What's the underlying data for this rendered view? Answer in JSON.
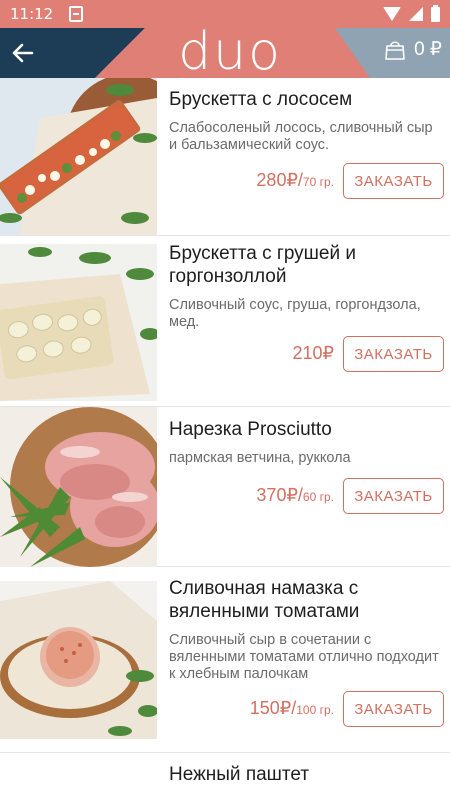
{
  "status_bar": {
    "time": "11:12"
  },
  "header": {
    "logo": "duo",
    "cart_count": "0 ₽"
  },
  "colors": {
    "accent": "#e07f75",
    "navy": "#1c3d55",
    "slate": "#8fa3b3",
    "price": "#d27061"
  },
  "menu": {
    "items": [
      {
        "name": "Брускетта с лососем",
        "description": "Слабосоленый лосось, сливочный сыр и бальзамический соус.",
        "price": "280₽/",
        "weight": "70 гр.",
        "button": "ЗАКАЗАТЬ"
      },
      {
        "name": "Брускетта с грушей и горгонзоллой",
        "description": "Сливочный соус, груша, горгондзола, мед.",
        "price": "210₽",
        "weight": "",
        "button": "ЗАКАЗАТЬ"
      },
      {
        "name": "Нарезка Prosciutto",
        "description": "пармская ветчина, руккола",
        "price": "370₽/",
        "weight": "60 гр.",
        "button": "ЗАКАЗАТЬ"
      },
      {
        "name": "Сливочная намазка с вяленными томатами",
        "description": "Сливочный сыр в сочетании с вяленными томатами отлично подходит к хлебным палочкам",
        "price": "150₽/",
        "weight": "100 гр.",
        "button": "ЗАКАЗАТЬ"
      },
      {
        "name": "Нежный паштет",
        "description": "",
        "price": "",
        "weight": "",
        "button": ""
      }
    ]
  }
}
